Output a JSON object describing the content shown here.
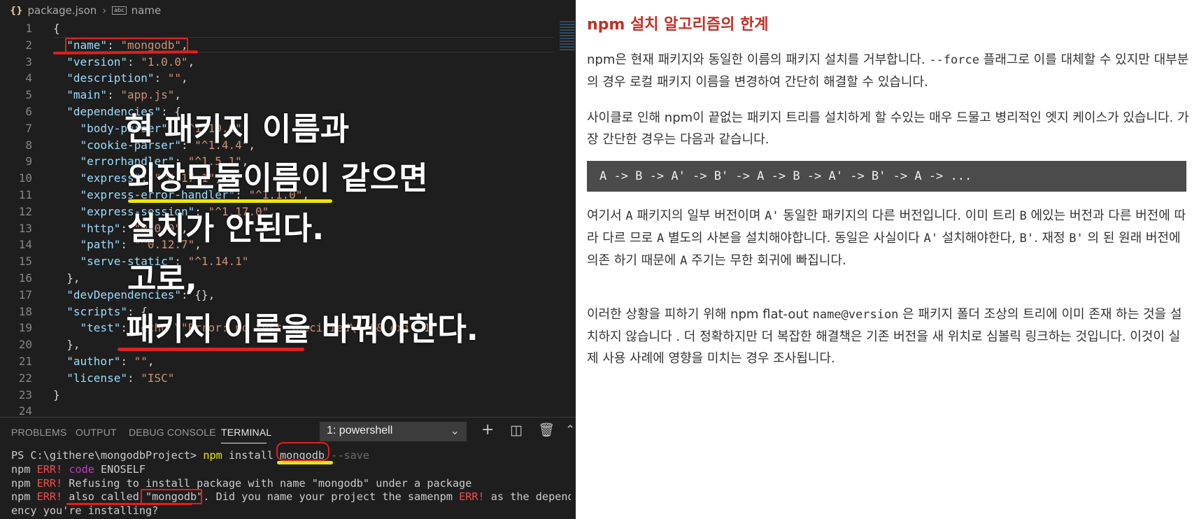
{
  "editor": {
    "breadcrumb": {
      "file": "package.json",
      "symbol": "name"
    },
    "lines": [
      {
        "n": "1",
        "html": "<span class=\"p\">{</span>"
      },
      {
        "n": "2",
        "html": "  <span class=\"k\">\"name\"</span><span class=\"p\">: </span><span class=\"s\">\"mongodb\"</span><span class=\"p\">,</span>"
      },
      {
        "n": "3",
        "html": "  <span class=\"k\">\"version\"</span><span class=\"p\">: </span><span class=\"s\">\"1.0.0\"</span><span class=\"p\">,</span>"
      },
      {
        "n": "4",
        "html": "  <span class=\"k\">\"description\"</span><span class=\"p\">: </span><span class=\"s\">\"\"</span><span class=\"p\">,</span>"
      },
      {
        "n": "5",
        "html": "  <span class=\"k\">\"main\"</span><span class=\"p\">: </span><span class=\"s\">\"app.js\"</span><span class=\"p\">,</span>"
      },
      {
        "n": "6",
        "html": "  <span class=\"k\">\"dependencies\"</span><span class=\"p\">: {</span>"
      },
      {
        "n": "7",
        "html": "    <span class=\"k\">\"body-parser\"</span><span class=\"p\">: </span><span class=\"s\">\"^1.19.0\"</span><span class=\"p\">,</span>"
      },
      {
        "n": "8",
        "html": "    <span class=\"k\">\"cookie-parser\"</span><span class=\"p\">: </span><span class=\"s\">\"^1.4.4\"</span><span class=\"p\">,</span>"
      },
      {
        "n": "9",
        "html": "    <span class=\"k\">\"errorhandler\"</span><span class=\"p\">: </span><span class=\"s\">\"^1.5.1\"</span><span class=\"p\">,</span>"
      },
      {
        "n": "10",
        "html": "    <span class=\"k\">\"express\"</span><span class=\"p\">: </span><span class=\"s\">\"^4.17.1\"</span><span class=\"p\">,</span>"
      },
      {
        "n": "11",
        "html": "    <span class=\"k\">\"express-error-handler\"</span><span class=\"p\">: </span><span class=\"s\">\"^1.1.0\"</span><span class=\"p\">,</span>"
      },
      {
        "n": "12",
        "html": "    <span class=\"k\">\"express-session\"</span><span class=\"p\">: </span><span class=\"s\">\"^1.17.0\"</span><span class=\"p\">,</span>"
      },
      {
        "n": "13",
        "html": "    <span class=\"k\">\"http\"</span><span class=\"p\">: </span><span class=\"s\">\"0.0.0\"</span><span class=\"p\">,</span>"
      },
      {
        "n": "14",
        "html": "    <span class=\"k\">\"path\"</span><span class=\"p\">: </span><span class=\"s\">\"^0.12.7\"</span><span class=\"p\">,</span>"
      },
      {
        "n": "15",
        "html": "    <span class=\"k\">\"serve-static\"</span><span class=\"p\">: </span><span class=\"s\">\"^1.14.1\"</span>"
      },
      {
        "n": "16",
        "html": "  <span class=\"p\">},</span>"
      },
      {
        "n": "17",
        "html": "  <span class=\"k\">\"devDependencies\"</span><span class=\"p\">: {},</span>"
      },
      {
        "n": "18",
        "html": "  <span class=\"k\">\"scripts\"</span><span class=\"p\">: {</span>"
      },
      {
        "n": "19",
        "html": "    <span class=\"k\">\"test\"</span><span class=\"p\">: </span><span class=\"s\">\"echo \\\"Error: no test specified\\\" &amp;&amp; exit 1\"</span>"
      },
      {
        "n": "20",
        "html": "  <span class=\"p\">},</span>"
      },
      {
        "n": "21",
        "html": "  <span class=\"k\">\"author\"</span><span class=\"p\">: </span><span class=\"s\">\"\"</span><span class=\"p\">,</span>"
      },
      {
        "n": "22",
        "html": "  <span class=\"k\">\"license\"</span><span class=\"p\">: </span><span class=\"s\">\"ISC\"</span>"
      },
      {
        "n": "23",
        "html": "<span class=\"p\">}</span>"
      },
      {
        "n": "24",
        "html": ""
      }
    ]
  },
  "overlay": {
    "line1": "현 패키지 이름과",
    "line2": "외장모듈이름이 같으면",
    "line3": "설치가 안된다.",
    "line4": "고로,",
    "line5": "패키지 이름을 바꿔야한다."
  },
  "panel": {
    "tabs": [
      "PROBLEMS",
      "OUTPUT",
      "DEBUG CONSOLE",
      "TERMINAL"
    ],
    "terminal_select": "1: powershell",
    "terminal_lines": [
      "PS C:\\githere\\mongodbProject> <span class=\"y\">npm</span> install mongodb <span class=\"dim\">--save</span>",
      "npm <span class=\"r\">ERR!</span> <span class=\"m\">code</span> ENOSELF",
      "npm <span class=\"r\">ERR!</span> Refusing to install package with name \"mongodb\" under a package",
      "npm <span class=\"r\">ERR!</span> also called \"mongodb\". Did you name your project the samenpm <span class=\"r\">ERR!</span> as the depend",
      "ency you're installing?"
    ]
  },
  "article": {
    "title": "npm 설치 알고리즘의 한계",
    "p1": "npm은 현재 패키지와 동일한 이름의 패키지 설치를 거부합니다. <span class=\"code-inline\">--force</span> 플래그로 이를 대체할 수 있지만 대부분의 경우 로컬 패키지 이름을 변경하여 간단히 해결할 수 있습니다.",
    "p2": "사이클로 인해 npm이 끝없는 패키지 트리를 설치하게 할 수있는 매우 드물고 병리적인 엣지 케이스가 있습니다. 가장 간단한 경우는 다음과 같습니다.",
    "code": "A -> B -> A' -> B' -> A -> B -> A' -> B' -> A -> ...",
    "p3": "여기서 <span class=\"code-inline\">A</span> 패키지의 일부 버전이며 <span class=\"code-inline\">A'</span> 동일한 패키지의 다른 버전입니다. 이미 트리 <span class=\"code-inline\">B</span> 에있는 버전과 다른 버전에 따라 다르 므로 <span class=\"code-inline\">A</span> 별도의 사본을 설치해야합니다. 동일은 사실이다 <span class=\"code-inline\">A'</span> 설치해야한다, <span class=\"code-inline\">B'</span>. 재정 <span class=\"code-inline\">B'</span> 의 된 원래 버전에 의존 하기 때문에 <span class=\"code-inline\">A</span> 주기는 무한 회귀에 빠집니다.",
    "p4": "이러한 상황을 피하기 위해 npm flat-out <span class=\"code-inline\">name@version</span> 은 패키지 폴더 조상의 트리에 이미 존재 하는 것을 설치하지 않습니다 . 더 정확하지만 더 복잡한 해결책은 기존 버전을 새 위치로 심볼릭 링크하는 것입니다. 이것이 실제 사용 사례에 영향을 미치는 경우 조사됩니다."
  },
  "colors": {
    "editor_bg": "#1e1e1e",
    "title_red": "#c03028",
    "annotation_red": "#e0201e",
    "annotation_yellow": "#f2e600"
  }
}
